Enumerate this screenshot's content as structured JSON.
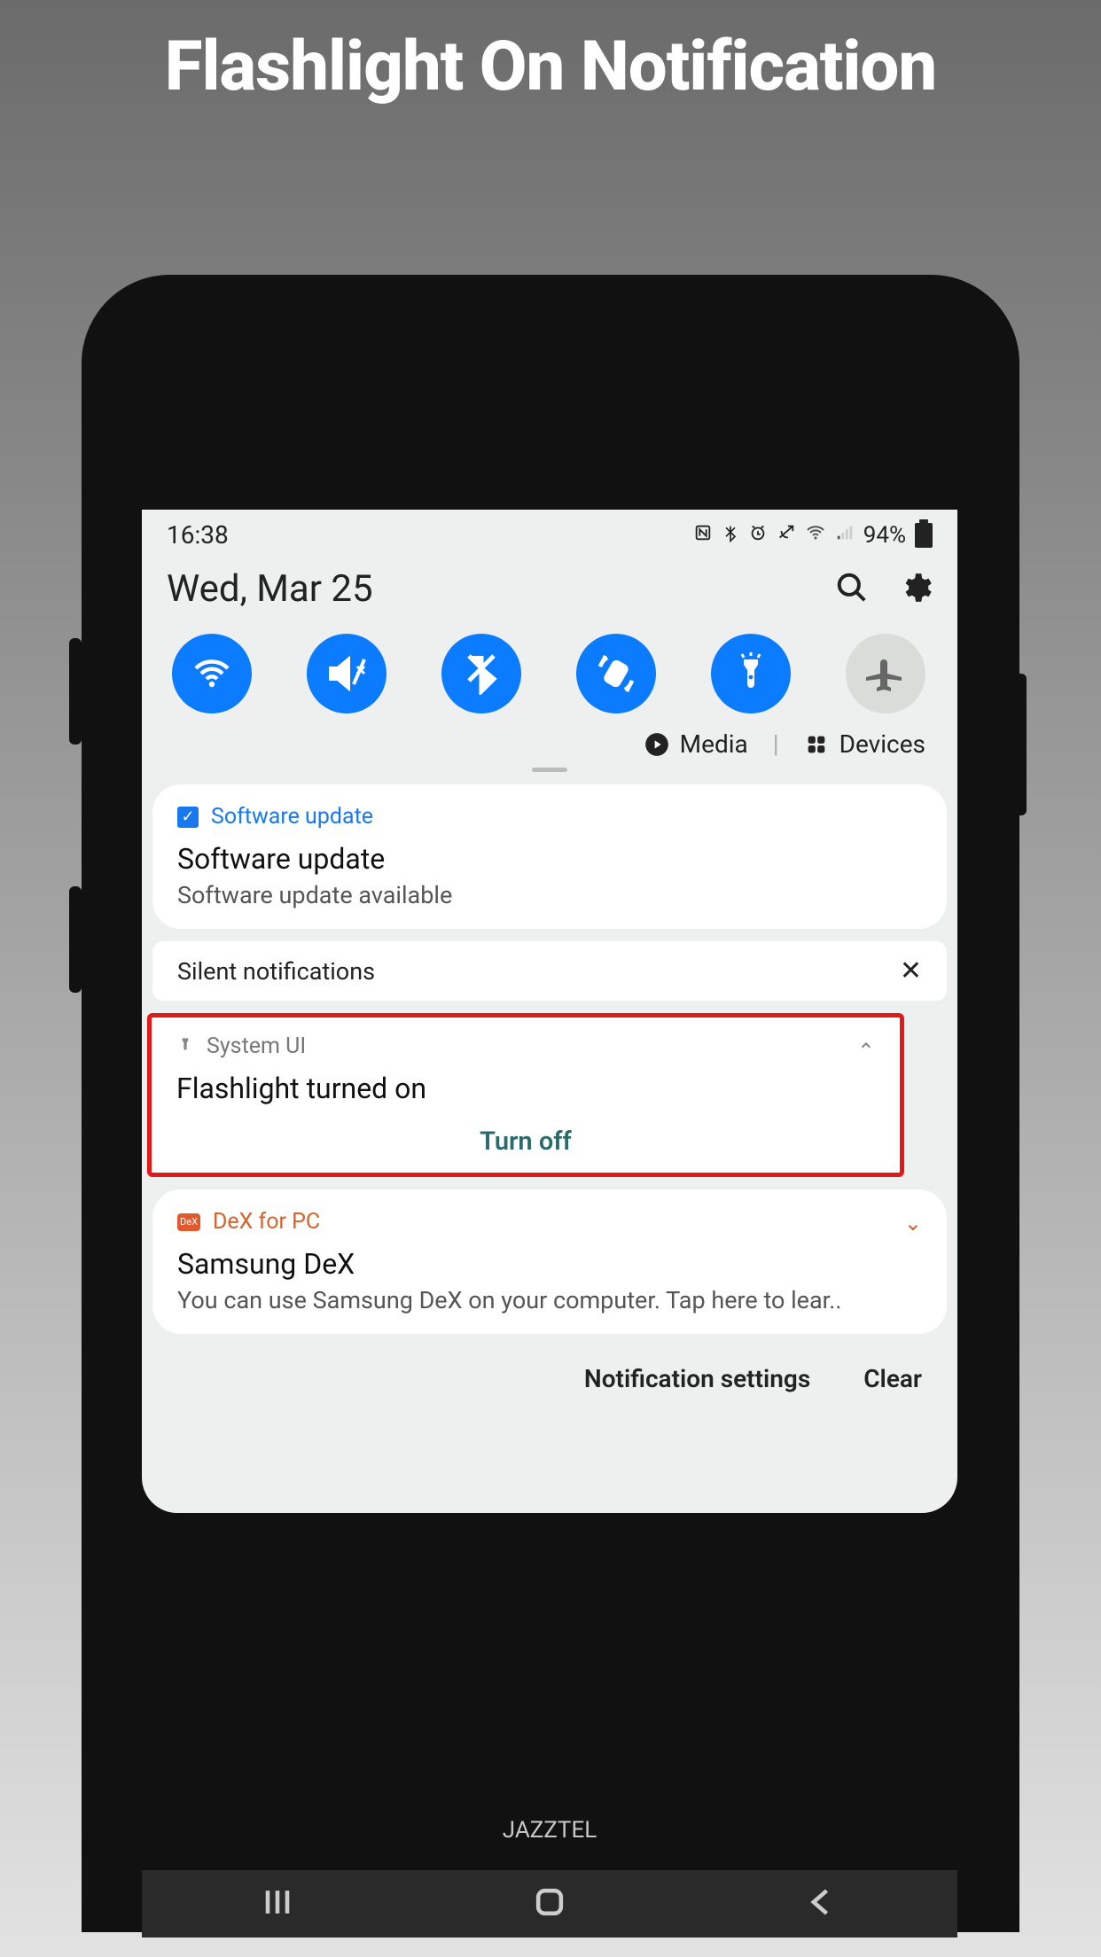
{
  "page": {
    "title": "Flashlight On Notification"
  },
  "status": {
    "time": "16:38",
    "battery": "94%"
  },
  "header": {
    "date": "Wed, Mar 25"
  },
  "qs": {
    "toggles": [
      {
        "name": "wifi",
        "on": true
      },
      {
        "name": "mute",
        "on": true
      },
      {
        "name": "bluetooth",
        "on": true
      },
      {
        "name": "autorotate",
        "on": true
      },
      {
        "name": "flashlight",
        "on": true
      },
      {
        "name": "airplane",
        "on": false
      }
    ],
    "media_label": "Media",
    "devices_label": "Devices"
  },
  "notifs": {
    "software": {
      "app": "Software update",
      "title": "Software update",
      "body": "Software update available"
    },
    "silent_header": "Silent notifications",
    "flashlight": {
      "app": "System UI",
      "title": "Flashlight turned on",
      "action": "Turn off"
    },
    "dex": {
      "app": "DeX for PC",
      "title": "Samsung DeX",
      "body": "You can use Samsung DeX on your computer. Tap here to lear.."
    }
  },
  "footer": {
    "settings": "Notification settings",
    "clear": "Clear"
  },
  "carrier": "JAZZTEL"
}
